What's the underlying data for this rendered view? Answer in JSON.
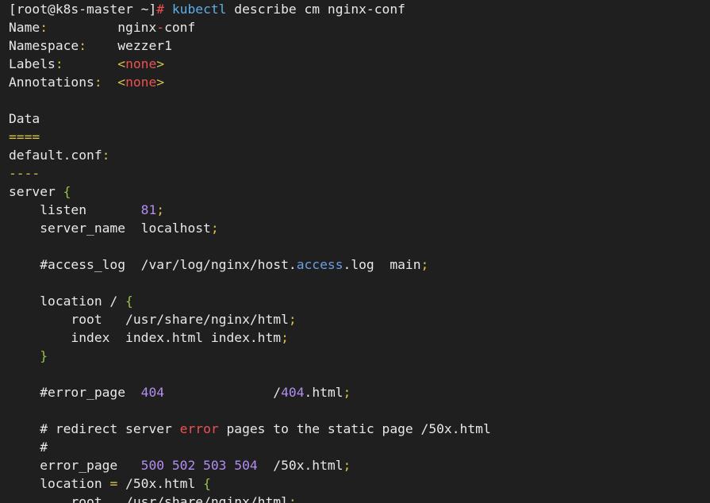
{
  "colors": {
    "background": "#1f1f1f",
    "text": "#e8e8e8",
    "yellow": "#d7c24a",
    "red": "#ef5050",
    "green": "#98c24c",
    "purple": "#b38cf0",
    "blue": "#6b9fe3",
    "cyan": "#5cb0e6"
  },
  "lines": [
    [
      {
        "t": "[root@k8s-master ~]",
        "c": "white"
      },
      {
        "t": "# ",
        "c": "red"
      },
      {
        "t": "kubectl ",
        "c": "cyan"
      },
      {
        "t": "describe cm nginx-conf",
        "c": "white"
      }
    ],
    [
      {
        "t": "Name",
        "c": "white"
      },
      {
        "t": ":",
        "c": "yellow"
      },
      {
        "t": "         nginx",
        "c": "white"
      },
      {
        "t": "-",
        "c": "red"
      },
      {
        "t": "conf",
        "c": "white"
      }
    ],
    [
      {
        "t": "Namespace",
        "c": "white"
      },
      {
        "t": ":",
        "c": "yellow"
      },
      {
        "t": "    wezzer1",
        "c": "white"
      }
    ],
    [
      {
        "t": "Labels",
        "c": "white"
      },
      {
        "t": ":",
        "c": "yellow"
      },
      {
        "t": "       ",
        "c": "white"
      },
      {
        "t": "<",
        "c": "yellow"
      },
      {
        "t": "none",
        "c": "red"
      },
      {
        "t": ">",
        "c": "yellow"
      }
    ],
    [
      {
        "t": "Annotations",
        "c": "white"
      },
      {
        "t": ":",
        "c": "yellow"
      },
      {
        "t": "  ",
        "c": "white"
      },
      {
        "t": "<",
        "c": "yellow"
      },
      {
        "t": "none",
        "c": "red"
      },
      {
        "t": ">",
        "c": "yellow"
      }
    ],
    [],
    [
      {
        "t": "Data",
        "c": "white"
      }
    ],
    [
      {
        "t": "====",
        "c": "yellow"
      }
    ],
    [
      {
        "t": "default.conf",
        "c": "white"
      },
      {
        "t": ":",
        "c": "yellow"
      }
    ],
    [
      {
        "t": "----",
        "c": "yellow"
      }
    ],
    [
      {
        "t": "server ",
        "c": "white"
      },
      {
        "t": "{",
        "c": "green"
      }
    ],
    [
      {
        "t": "    listen       ",
        "c": "white"
      },
      {
        "t": "81",
        "c": "purple"
      },
      {
        "t": ";",
        "c": "yellow"
      }
    ],
    [
      {
        "t": "    server_name  localhost",
        "c": "white"
      },
      {
        "t": ";",
        "c": "yellow"
      }
    ],
    [],
    [
      {
        "t": "    #access_log  /var/log/nginx/host.",
        "c": "white"
      },
      {
        "t": "access",
        "c": "blue"
      },
      {
        "t": ".log  main",
        "c": "white"
      },
      {
        "t": ";",
        "c": "yellow"
      }
    ],
    [],
    [
      {
        "t": "    location / ",
        "c": "white"
      },
      {
        "t": "{",
        "c": "green"
      }
    ],
    [
      {
        "t": "        root   /usr/share/nginx/html",
        "c": "white"
      },
      {
        "t": ";",
        "c": "yellow"
      }
    ],
    [
      {
        "t": "        index  index.html index.htm",
        "c": "white"
      },
      {
        "t": ";",
        "c": "yellow"
      }
    ],
    [
      {
        "t": "    ",
        "c": "white"
      },
      {
        "t": "}",
        "c": "green"
      }
    ],
    [],
    [
      {
        "t": "    #error_page  ",
        "c": "white"
      },
      {
        "t": "404",
        "c": "purple"
      },
      {
        "t": "              /",
        "c": "white"
      },
      {
        "t": "404",
        "c": "purple"
      },
      {
        "t": ".html",
        "c": "white"
      },
      {
        "t": ";",
        "c": "yellow"
      }
    ],
    [],
    [
      {
        "t": "    # redirect server ",
        "c": "white"
      },
      {
        "t": "error",
        "c": "red"
      },
      {
        "t": " pages to the static page /50x.html",
        "c": "white"
      }
    ],
    [
      {
        "t": "    #",
        "c": "white"
      }
    ],
    [
      {
        "t": "    error_page   ",
        "c": "white"
      },
      {
        "t": "500 502 503 504",
        "c": "purple"
      },
      {
        "t": "  /50x.html",
        "c": "white"
      },
      {
        "t": ";",
        "c": "yellow"
      }
    ],
    [
      {
        "t": "    location ",
        "c": "white"
      },
      {
        "t": "=",
        "c": "yellow"
      },
      {
        "t": " /50x.html ",
        "c": "white"
      },
      {
        "t": "{",
        "c": "green"
      }
    ],
    [
      {
        "t": "        root   /usr/share/nginx/html",
        "c": "white"
      },
      {
        "t": ";",
        "c": "yellow"
      }
    ]
  ]
}
